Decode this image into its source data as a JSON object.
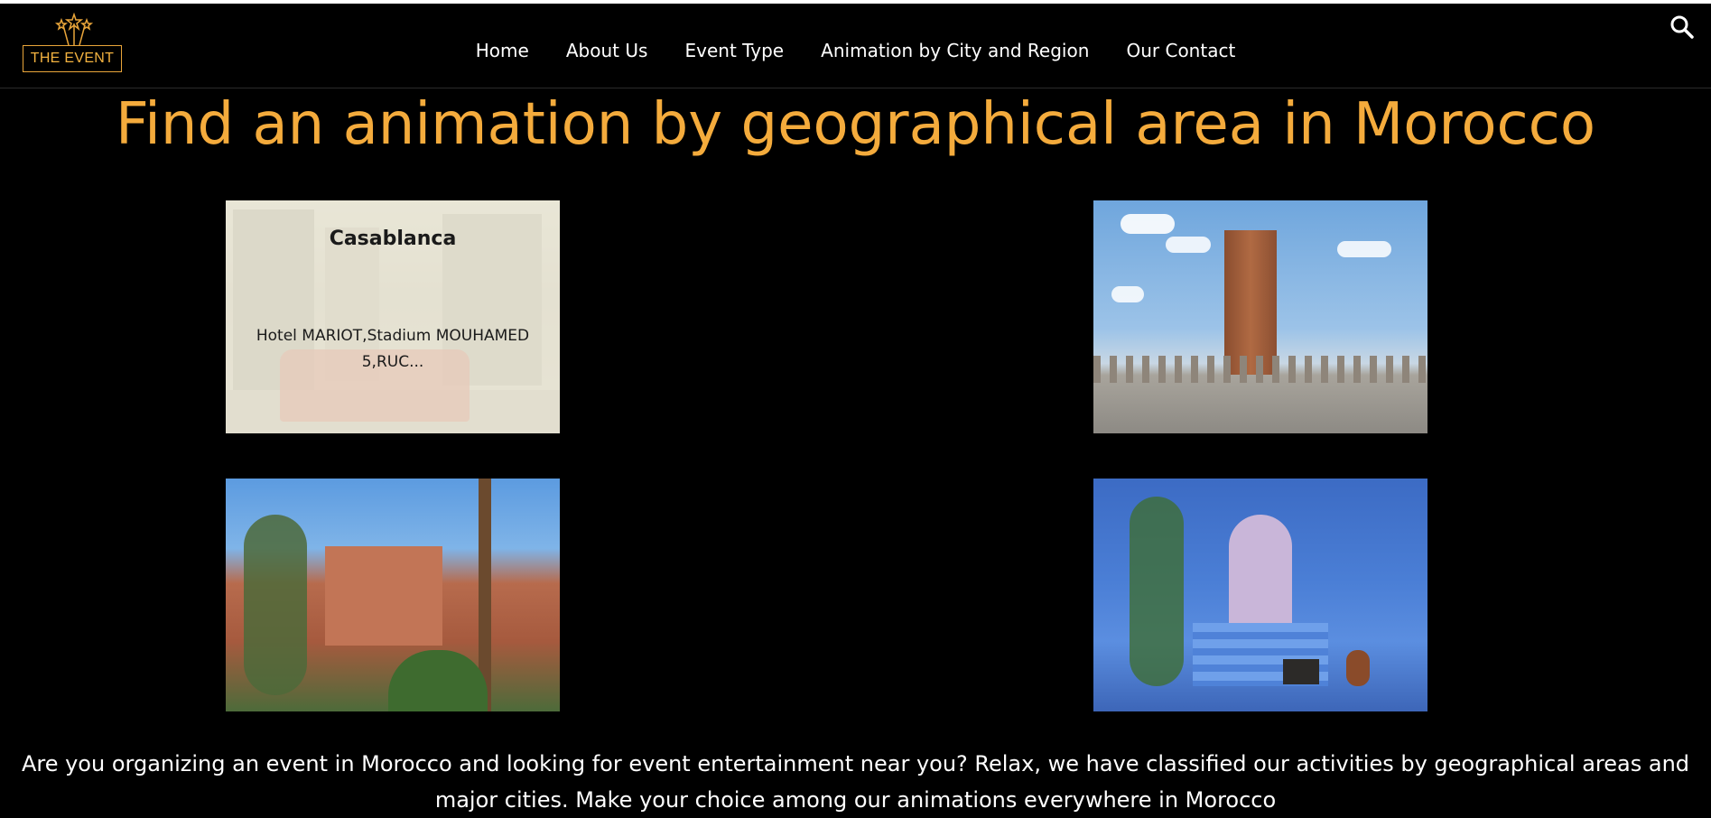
{
  "header": {
    "logo_text": "THE EVENT",
    "nav": [
      {
        "label": "Home"
      },
      {
        "label": "About Us"
      },
      {
        "label": "Event Type"
      },
      {
        "label": "Animation by City and Region"
      },
      {
        "label": "Our Contact"
      }
    ],
    "search_icon": "search-icon"
  },
  "page": {
    "title": "Find an animation by geographical area in Morocco",
    "intro": "Are you organizing an event in Morocco and looking for event entertainment near you? Relax, we have classified our activities by geographical areas and major cities. Make your choice among our animations everywhere in Morocco"
  },
  "cards": [
    {
      "title": "Casablanca",
      "description": "Hotel MARIOT,Stadium MOUHAMED 5,RUC..."
    }
  ],
  "colors": {
    "accent": "#f4ab3c",
    "background": "#000000",
    "text": "#ffffff"
  }
}
